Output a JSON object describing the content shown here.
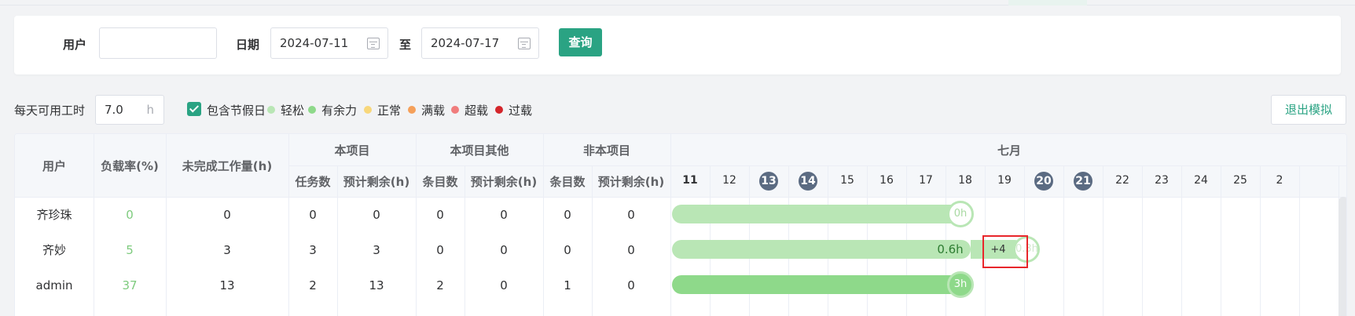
{
  "filters": {
    "user_label": "用户",
    "user_value": "",
    "date_label": "日期",
    "date_from": "2024-07-11",
    "to_label": "至",
    "date_to": "2024-07-17",
    "query_label": "查询"
  },
  "options": {
    "hours_label": "每天可用工时",
    "hours_value": "7.0",
    "hours_unit": "h",
    "include_holidays_label": "包含节假日",
    "include_holidays_checked": true,
    "exit_label": "退出模拟",
    "legend": [
      {
        "label": "轻松",
        "color": "#b9e6b5"
      },
      {
        "label": "有余力",
        "color": "#8ed98a"
      },
      {
        "label": "正常",
        "color": "#f8d77b"
      },
      {
        "label": "满载",
        "color": "#f5a05a"
      },
      {
        "label": "超载",
        "color": "#f07c7c"
      },
      {
        "label": "过载",
        "color": "#d4252b"
      }
    ]
  },
  "table": {
    "headers": {
      "user": "用户",
      "load_rate": "负载率(%)",
      "unfinished": "未完成工作量(h)",
      "this_project": "本项目",
      "this_project_other": "本项目其他",
      "non_project": "非本项目",
      "task_count": "任务数",
      "est_remaining": "预计剩余(h)",
      "item_count": "条目数",
      "month": "七月"
    },
    "days": [
      {
        "d": "11",
        "holiday": false,
        "bold": true
      },
      {
        "d": "12",
        "holiday": false
      },
      {
        "d": "13",
        "holiday": true
      },
      {
        "d": "14",
        "holiday": true
      },
      {
        "d": "15",
        "holiday": false
      },
      {
        "d": "16",
        "holiday": false
      },
      {
        "d": "17",
        "holiday": false
      },
      {
        "d": "18",
        "holiday": false
      },
      {
        "d": "19",
        "holiday": false
      },
      {
        "d": "20",
        "holiday": true
      },
      {
        "d": "21",
        "holiday": true
      },
      {
        "d": "22",
        "holiday": false
      },
      {
        "d": "23",
        "holiday": false
      },
      {
        "d": "24",
        "holiday": false
      },
      {
        "d": "25",
        "holiday": false
      },
      {
        "d": "2",
        "holiday": false
      }
    ],
    "rows": [
      {
        "user": "齐珍珠",
        "rate": "0",
        "unfinished": "0",
        "tasks": "0",
        "remain": "0",
        "other_items": "0",
        "other_remain": "0",
        "non_items": "0",
        "non_remain": "0",
        "bar_label": "0h"
      },
      {
        "user": "齐妙",
        "rate": "5",
        "unfinished": "3",
        "tasks": "3",
        "remain": "3",
        "other_items": "0",
        "other_remain": "0",
        "non_items": "0",
        "non_remain": "0",
        "bar_label": "0.6h",
        "extra_label": "+4",
        "end_label": "0.3h"
      },
      {
        "user": "admin",
        "rate": "37",
        "unfinished": "13",
        "tasks": "2",
        "remain": "13",
        "other_items": "2",
        "other_remain": "0",
        "non_items": "1",
        "non_remain": "0",
        "bar_label": "3h"
      }
    ]
  }
}
